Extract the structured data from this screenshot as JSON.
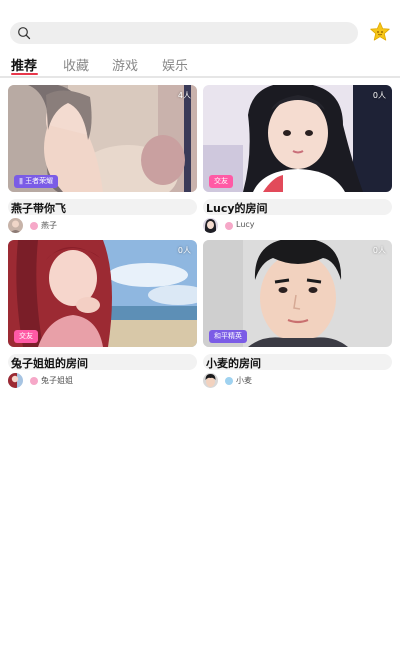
{
  "search": {
    "placeholder": ""
  },
  "tabs": [
    {
      "label": "推荐",
      "active": true
    },
    {
      "label": "收藏",
      "active": false
    },
    {
      "label": "游戏",
      "active": false
    },
    {
      "label": "娱乐",
      "active": false
    }
  ],
  "rooms": [
    {
      "title": "燕子带你飞",
      "count": "4人",
      "tag": "王者荣耀",
      "owner": "燕子",
      "gender": "female"
    },
    {
      "title": "Lucy的房间",
      "count": "0人",
      "tag": "交友",
      "owner": "Lucy",
      "gender": "female"
    },
    {
      "title": "兔子姐姐的房间",
      "count": "0人",
      "tag": "交友",
      "owner": "兔子姐姐",
      "gender": "female"
    },
    {
      "title": "小麦的房间",
      "count": "0人",
      "tag": "和平精英",
      "owner": "小麦",
      "gender": "male"
    }
  ],
  "colors": {
    "accent": "#e8374b",
    "tag_purple": "#7b5ce6",
    "tag_pink": "#ff5aa5",
    "star": "#f5c518"
  },
  "icons": [
    "search-icon",
    "star-icon"
  ]
}
